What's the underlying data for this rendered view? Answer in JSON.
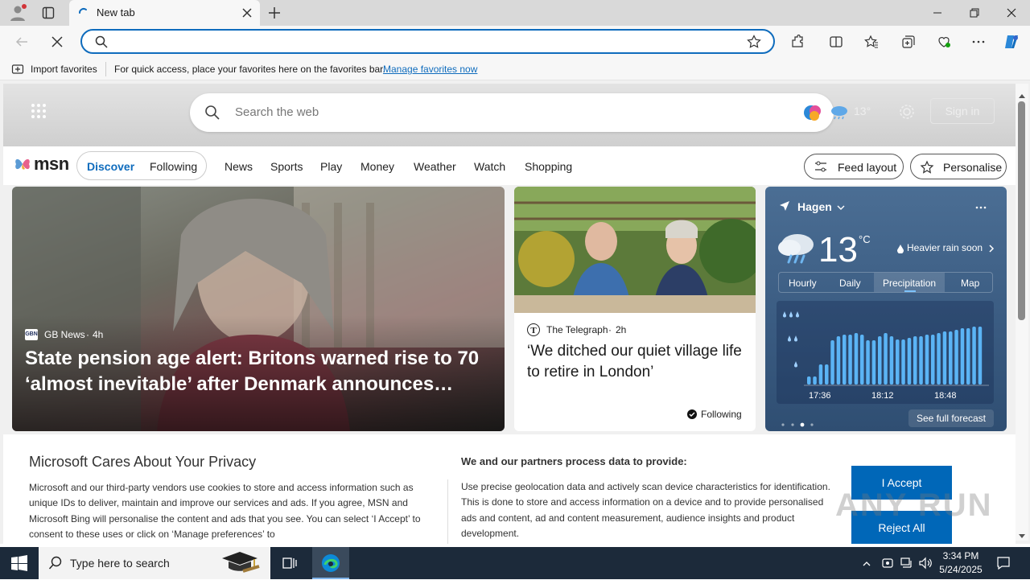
{
  "browser": {
    "tab_title": "New tab",
    "address_value": "",
    "favorites_bar": {
      "import_label": "Import favorites",
      "message": "For quick access, place your favorites here on the favorites bar.",
      "manage_link": "Manage favorites now"
    }
  },
  "msn": {
    "search_placeholder": "Search the web",
    "weather_chip_temp": "13°",
    "sign_in": "Sign in",
    "logo_text": "msn",
    "pills": [
      "Discover",
      "Following"
    ],
    "nav": [
      "News",
      "Sports",
      "Play",
      "Money",
      "Weather",
      "Watch",
      "Shopping"
    ],
    "feed_layout": "Feed layout",
    "personalise": "Personalise"
  },
  "cards": {
    "main": {
      "source": "GB News",
      "source_badge": "GBN",
      "age": "4h",
      "headline": "State pension age alert: Britons warned rise to 70 ‘almost inevitable’ after Denmark announces…"
    },
    "second": {
      "source": "The Telegraph",
      "age": "2h",
      "headline": "‘We ditched our quiet village life to retire in London’",
      "following": "Following"
    }
  },
  "weather": {
    "location": "Hagen",
    "temp": "13",
    "unit": "°C",
    "condition": "Heavier rain soon",
    "tabs": [
      "Hourly",
      "Daily",
      "Precipitation",
      "Map"
    ],
    "active_tab": "Precipitation",
    "time_labels": [
      "17:36",
      "18:12",
      "18:48"
    ],
    "see_full_forecast": "See full forecast"
  },
  "chart_data": {
    "type": "bar",
    "title": "",
    "x_ticks": [
      "17:36",
      "18:12",
      "18:48"
    ],
    "values": [
      0.1,
      0.1,
      0.25,
      0.25,
      0.55,
      0.6,
      0.62,
      0.62,
      0.64,
      0.62,
      0.55,
      0.55,
      0.6,
      0.64,
      0.6,
      0.56,
      0.56,
      0.58,
      0.6,
      0.6,
      0.62,
      0.62,
      0.64,
      0.66,
      0.66,
      0.68,
      0.7,
      0.7,
      0.72,
      0.72
    ],
    "ylim": [
      0,
      1
    ]
  },
  "privacy": {
    "title": "Microsoft Cares About Your Privacy",
    "body": "Microsoft and our third-party vendors use cookies to store and access information such as unique IDs to deliver, maintain and improve our services and ads. If you agree, MSN and Microsoft Bing will personalise the content and ads that you see. You can select ‘I Accept’ to consent to these uses or click on ‘Manage preferences’ to",
    "partners_title": "We and our partners process data to provide:",
    "partners_body": "Use precise geolocation data and actively scan device characteristics for identification. This is done to store and access information on a device and to provide personalised ads and content, ad and content measurement, audience insights and product development.",
    "accept": "I Accept",
    "reject": "Reject All"
  },
  "taskbar": {
    "search_placeholder": "Type here to search",
    "time": "3:34 PM",
    "date": "5/24/2025"
  },
  "watermark": "ANY RUN"
}
